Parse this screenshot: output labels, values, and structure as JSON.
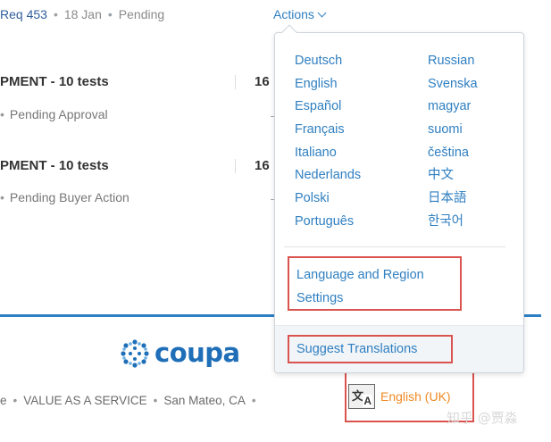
{
  "header": {
    "req": "Req 453",
    "sep": "•",
    "date": "18 Jan",
    "status": "Pending",
    "actions_label": "Actions"
  },
  "requisitions": [
    {
      "title": "PMENT - 10 tests",
      "status": "Pending Approval",
      "count": "16"
    },
    {
      "title": "PMENT - 10 tests",
      "status": "Pending Buyer Action",
      "count": "16"
    }
  ],
  "menu": {
    "languages_left": [
      "Deutsch",
      "English",
      "Español",
      "Français",
      "Italiano",
      "Nederlands",
      "Polski",
      "Português"
    ],
    "languages_right": [
      "Russian",
      "Svenska",
      "magyar",
      "suomi",
      "čeština",
      "中文",
      "日本語",
      "한국어"
    ],
    "language_region_line1": "Language and Region",
    "language_region_line2": "Settings",
    "suggest_translations": "Suggest Translations"
  },
  "footer": {
    "logo_text": "coupa",
    "prefix": "e",
    "sep": "•",
    "tagline": "VALUE AS A SERVICE",
    "location": "San Mateo, CA",
    "current_language": "English (UK)"
  },
  "watermark": "知乎 @贾淼",
  "colors": {
    "link": "#2f7fc1",
    "accent_bar": "#2c7fc4",
    "highlight_box": "#d9534f",
    "language_label": "#f08a24"
  }
}
